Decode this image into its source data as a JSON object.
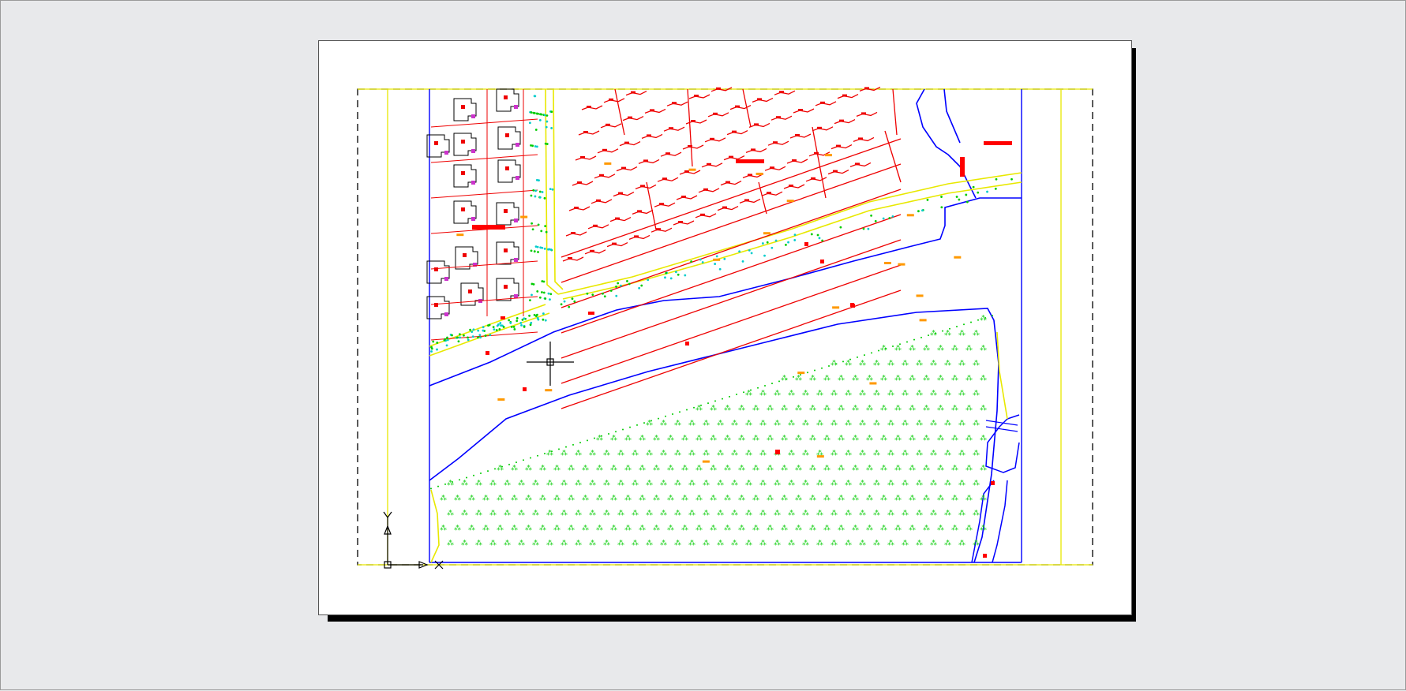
{
  "layout_view": {
    "background_color": "#e8e9eb",
    "paper_color": "#ffffff",
    "shadow_color": "#000000"
  },
  "cad_colors": {
    "plot_area_border": "#000000",
    "site_boundary": "#0000ff",
    "road_lines": "#ffff00",
    "buildings": "#ff0000",
    "trees": "#00cc00",
    "shrubs": "#00cccc",
    "labels": "#ff8000",
    "house_outline": "#000000",
    "ucs_icon": "#000000"
  },
  "ucs_icon": {
    "y_axis_label": "Y",
    "x_axis_label": "X"
  }
}
